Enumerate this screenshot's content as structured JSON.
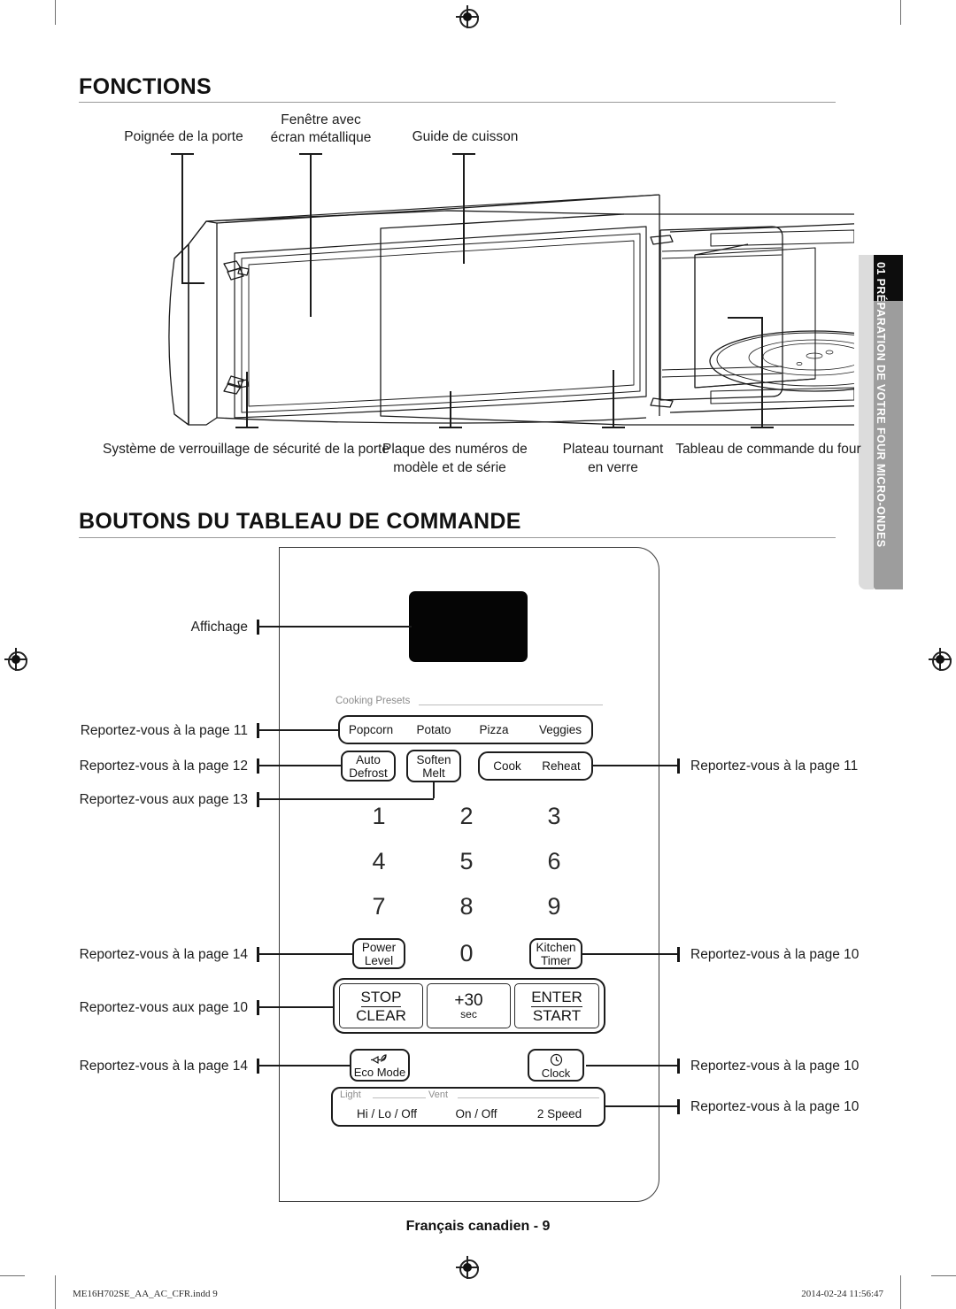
{
  "page": {
    "section_tab": "01  PRÉPARATION DE VOTRE FOUR MICRO-ONDES",
    "footer_page": "Français canadien -  9",
    "footer_file": "ME16H702SE_AA_AC_CFR.indd   9",
    "footer_date": "2014-02-24       11:56:47"
  },
  "features": {
    "heading": "FONCTIONS",
    "callouts_top": [
      {
        "id": "door-handle",
        "text": "Poignée de la porte"
      },
      {
        "id": "window",
        "line1": "Fenêtre avec",
        "line2": "écran métallique"
      },
      {
        "id": "cooking-guide",
        "text": "Guide de cuisson"
      }
    ],
    "callouts_bottom": [
      {
        "id": "door-lock",
        "line1": "Système de verrouillage de sécurité de la porte",
        "line2": ""
      },
      {
        "id": "model-plate",
        "line1": "Plaque des numéros de",
        "line2": "modèle et de série"
      },
      {
        "id": "turntable",
        "line1": "Plateau tournant",
        "line2": "en verre"
      },
      {
        "id": "control-panel",
        "line1": "Tableau de commande du four",
        "line2": ""
      }
    ]
  },
  "control_panel": {
    "heading": "BOUTONS DU TABLEAU DE COMMANDE",
    "left_callouts": [
      {
        "id": "display",
        "text": "Affichage"
      },
      {
        "id": "presets-ref",
        "text": "Reportez-vous à la page 11"
      },
      {
        "id": "defrost-ref",
        "text": "Reportez-vous à la page 12"
      },
      {
        "id": "keypad-ref",
        "text": "Reportez-vous aux page 13"
      },
      {
        "id": "power-level-ref",
        "text": "Reportez-vous à la page 14"
      },
      {
        "id": "stopclear-ref",
        "text": "Reportez-vous aux page 10"
      },
      {
        "id": "eco-mode-ref",
        "text": "Reportez-vous à la page 14"
      }
    ],
    "right_callouts": [
      {
        "id": "cook-reheat-ref",
        "text": "Reportez-vous à la page 11"
      },
      {
        "id": "kitchen-timer-ref",
        "text": "Reportez-vous à la page 10"
      },
      {
        "id": "clock-ref",
        "text": "Reportez-vous à la page 10"
      },
      {
        "id": "light-vent-ref",
        "text": "Reportez-vous à la page 10"
      }
    ],
    "group_labels": {
      "cooking_presets": "Cooking Presets",
      "light": "Light",
      "vent": "Vent"
    },
    "preset_row": [
      "Popcorn",
      "Potato",
      "Pizza",
      "Veggies"
    ],
    "second_row": {
      "auto_defrost_l1": "Auto",
      "auto_defrost_l2": "Defrost",
      "soften_l1": "Soften",
      "soften_l2": "Melt",
      "cook": "Cook",
      "reheat": "Reheat"
    },
    "keypad": [
      "1",
      "2",
      "3",
      "4",
      "5",
      "6",
      "7",
      "8",
      "9"
    ],
    "zero": "0",
    "power_level_l1": "Power",
    "power_level_l2": "Level",
    "kitchen_timer_l1": "Kitchen",
    "kitchen_timer_l2": "Timer",
    "stop_l1": "STOP",
    "stop_l2": "CLEAR",
    "plus30_l1": "+30",
    "plus30_l2": "sec",
    "enter_l1": "ENTER",
    "enter_l2": "START",
    "eco_mode": "Eco Mode",
    "clock": "Clock",
    "light_vent_row": [
      "Hi / Lo / Off",
      "On / Off",
      "2 Speed"
    ]
  },
  "colors": {
    "ink": "#1a1a1a",
    "rule": "#9a9a9a",
    "tab_gray": "#9d9d9d",
    "tab_light": "#dcdcdc",
    "display_black": "#050505",
    "muted": "#8d8d8d"
  }
}
